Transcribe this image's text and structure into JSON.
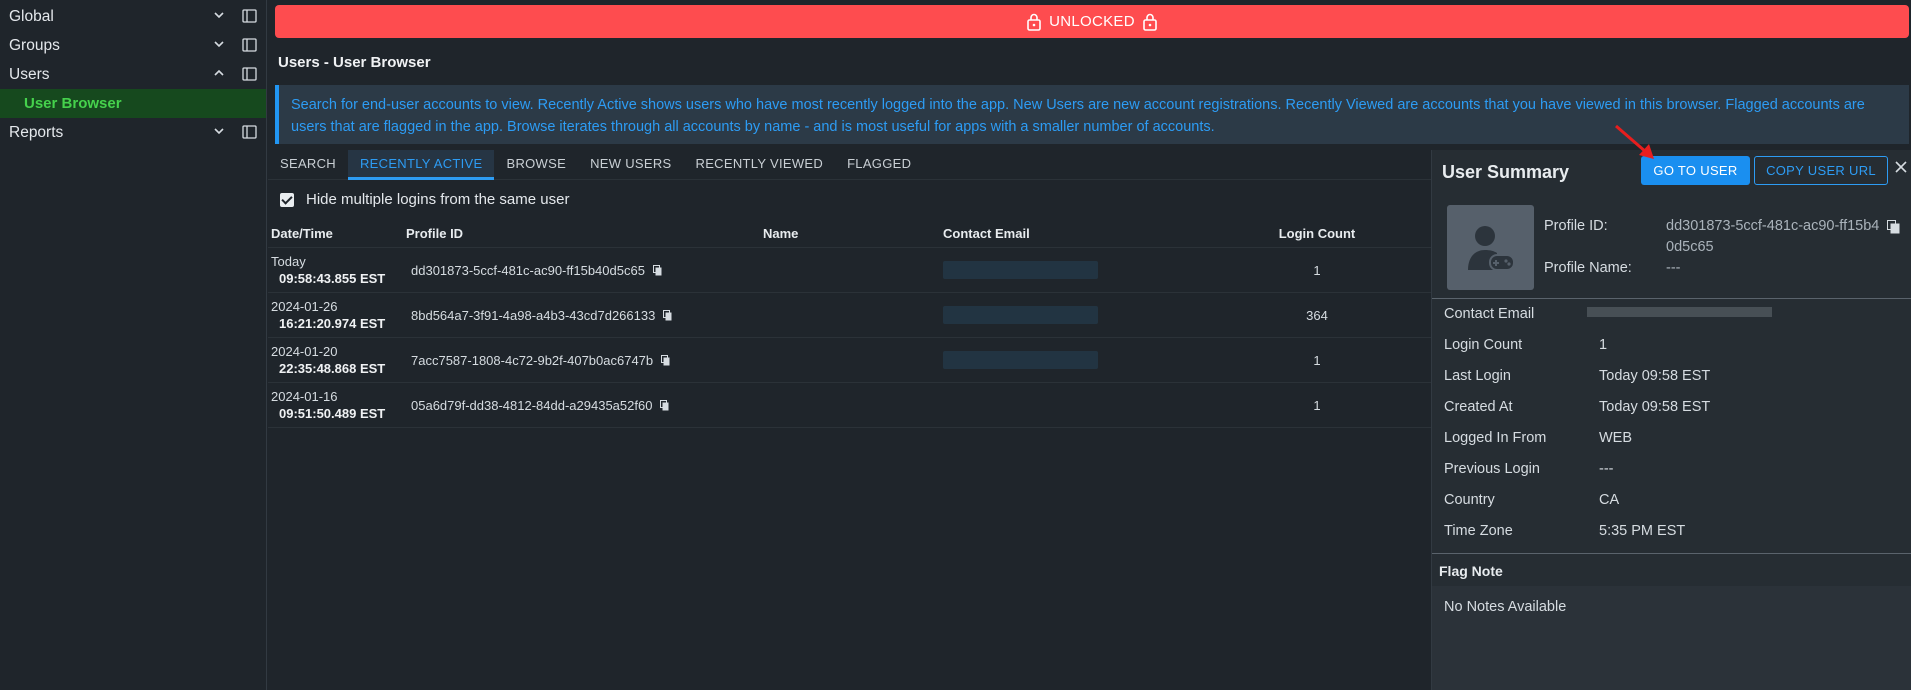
{
  "sidebar": {
    "items": [
      {
        "label": "Global"
      },
      {
        "label": "Groups"
      },
      {
        "label": "Users"
      },
      {
        "label": "User Browser"
      },
      {
        "label": "Reports"
      }
    ]
  },
  "banner": {
    "label": "UNLOCKED",
    "color": "#fe4c4f"
  },
  "page": {
    "title": "Users - User Browser",
    "info": "Search for end-user accounts to view. Recently Active shows users who have most recently logged into the app. New Users are new account registrations. Recently Viewed are accounts that you have viewed in this browser. Flagged accounts are users that are flagged in the app. Browse iterates through all accounts by name - and is most useful for apps with a smaller number of accounts."
  },
  "tabs": [
    {
      "label": "SEARCH"
    },
    {
      "label": "RECENTLY ACTIVE",
      "active": true
    },
    {
      "label": "BROWSE"
    },
    {
      "label": "NEW USERS"
    },
    {
      "label": "RECENTLY VIEWED"
    },
    {
      "label": "FLAGGED"
    }
  ],
  "filter": {
    "hide_multiple_label": "Hide multiple logins from the same user",
    "checked": true
  },
  "table": {
    "headers": {
      "date": "Date/Time",
      "profile_id": "Profile ID",
      "name": "Name",
      "email": "Contact Email",
      "count": "Login Count"
    },
    "rows": [
      {
        "date": "Today",
        "time": "09:58:43.855 EST",
        "profile_id": "dd301873-5ccf-481c-ac90-ff15b40d5c65",
        "name": "",
        "count": "1"
      },
      {
        "date": "2024-01-26",
        "time": "16:21:20.974 EST",
        "profile_id": "8bd564a7-3f91-4a98-a4b3-43cd7d266133",
        "name": "",
        "count": "364"
      },
      {
        "date": "2024-01-20",
        "time": "22:35:48.868 EST",
        "profile_id": "7acc7587-1808-4c72-9b2f-407b0ac6747b",
        "name": "",
        "count": "1"
      },
      {
        "date": "2024-01-16",
        "time": "09:51:50.489 EST",
        "profile_id": "05a6d79f-dd38-4812-84dd-a29435a52f60",
        "name": "",
        "count": "1"
      }
    ]
  },
  "summary": {
    "title": "User Summary",
    "go_to_user": "GO TO USER",
    "copy_url": "COPY USER URL",
    "profile_id_label": "Profile ID:",
    "profile_id_value": "dd301873-5ccf-481c-ac90-ff15b40d5c65",
    "profile_name_label": "Profile Name:",
    "profile_name_value": "---",
    "fields": [
      {
        "label": "Contact Email",
        "value": ""
      },
      {
        "label": "Login Count",
        "value": "1"
      },
      {
        "label": "Last Login",
        "value": "Today 09:58 EST"
      },
      {
        "label": "Created At",
        "value": "Today 09:58 EST"
      },
      {
        "label": "Logged In From",
        "value": "WEB"
      },
      {
        "label": "Previous Login",
        "value": "---"
      },
      {
        "label": "Country",
        "value": "CA"
      },
      {
        "label": "Time Zone",
        "value": "5:35 PM EST"
      }
    ],
    "flag_note_title": "Flag Note",
    "flag_note_value": "No Notes Available"
  }
}
